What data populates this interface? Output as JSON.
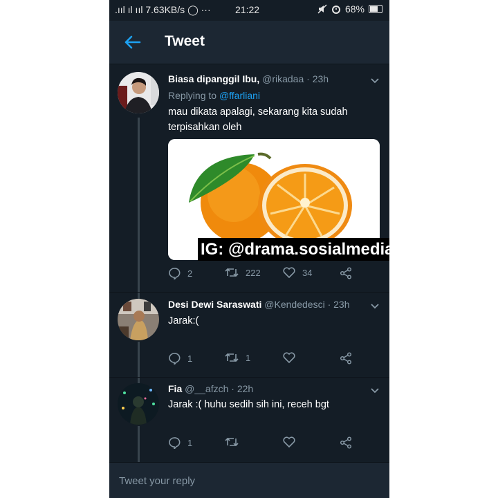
{
  "status_bar": {
    "signal_left": ".ııl ıl ııl",
    "network_speed": "7.63KB/s",
    "time": "21:22",
    "battery": "68%"
  },
  "header": {
    "title": "Tweet"
  },
  "tweets": [
    {
      "name": "Biasa dipanggil Ibu,",
      "meta": "@rikadaa · 23h",
      "reply_prefix": "Replying to",
      "reply_handle": "@ffarliani",
      "text_line1": "mau dikata apalagi, sekarang kita sudah",
      "text_line2": "terpisahkan oleh",
      "media": "orange-halves-image",
      "replies": "2",
      "retweets": "222",
      "likes": "34"
    },
    {
      "name": "Desi Dewi Saraswati",
      "meta": "@Kendedesci · 23h",
      "text": "Jarak:(",
      "replies": "1",
      "retweets": "1",
      "likes": ""
    },
    {
      "name": "Fia",
      "meta": "@__afzch · 22h",
      "text": "Jarak :( huhu sedih sih ini, receh bgt",
      "replies": "1",
      "retweets": "",
      "likes": ""
    }
  ],
  "watermark": "IG: @drama.sosialmedia",
  "reply_box": {
    "placeholder": "Tweet your reply"
  },
  "colors": {
    "background": "#141d26",
    "header": "#1c2733",
    "muted": "#8899a6",
    "link": "#1da1f2"
  }
}
